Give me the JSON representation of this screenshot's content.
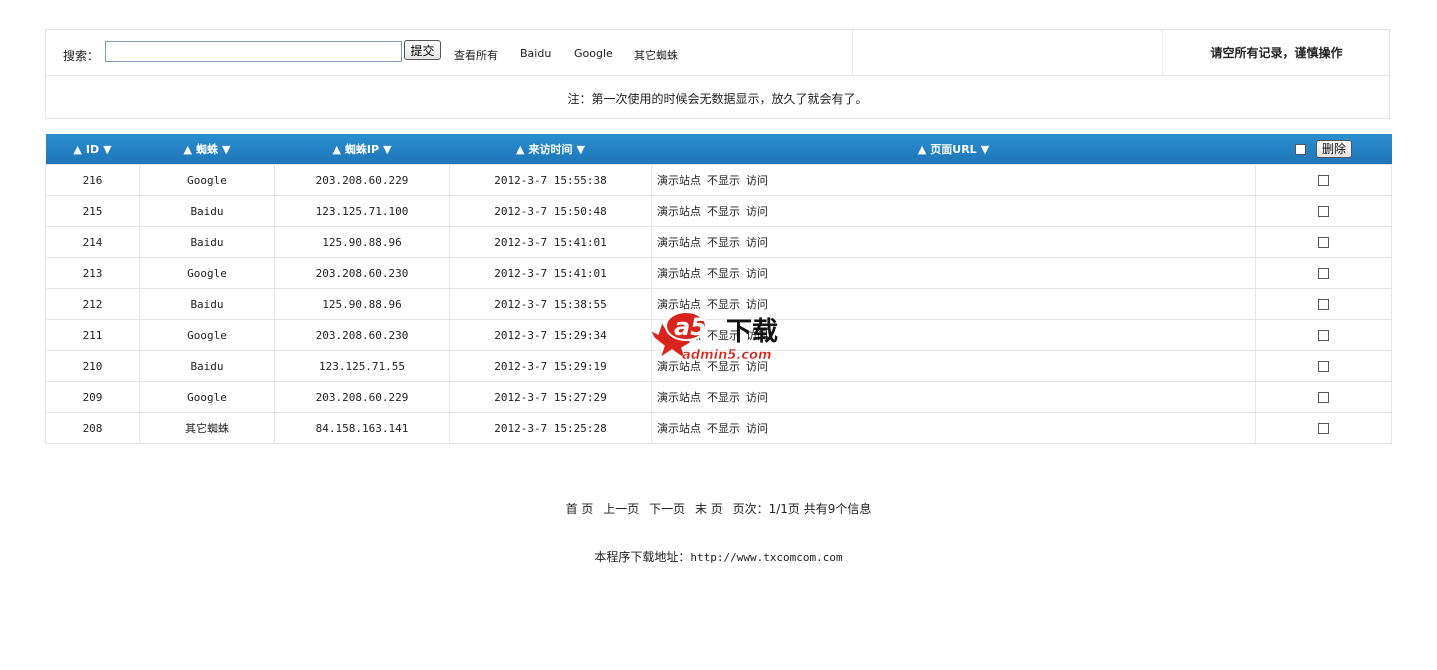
{
  "search": {
    "label": "搜索：",
    "value": "",
    "submit_label": "提交",
    "filters": [
      "查看所有",
      "Baidu",
      "Google",
      "其它蜘蛛"
    ]
  },
  "clear_all_label": "请空所有记录，谨慎操作",
  "note": "注：第一次使用的时候会无数据显示，放久了就会有了。",
  "table": {
    "headers": [
      "ID",
      "蜘蛛",
      "蜘蛛IP",
      "来访时间",
      "页面URL"
    ],
    "delete_label": "删除",
    "rows": [
      {
        "id": "216",
        "spider": "Google",
        "ip": "203.208.60.229",
        "time": "2012-3-7 15:55:38",
        "site": "演示站点",
        "hide": "不显示",
        "visit": "访问"
      },
      {
        "id": "215",
        "spider": "Baidu",
        "ip": "123.125.71.100",
        "time": "2012-3-7 15:50:48",
        "site": "演示站点",
        "hide": "不显示",
        "visit": "访问"
      },
      {
        "id": "214",
        "spider": "Baidu",
        "ip": "125.90.88.96",
        "time": "2012-3-7 15:41:01",
        "site": "演示站点",
        "hide": "不显示",
        "visit": "访问"
      },
      {
        "id": "213",
        "spider": "Google",
        "ip": "203.208.60.230",
        "time": "2012-3-7 15:41:01",
        "site": "演示站点",
        "hide": "不显示",
        "visit": "访问"
      },
      {
        "id": "212",
        "spider": "Baidu",
        "ip": "125.90.88.96",
        "time": "2012-3-7 15:38:55",
        "site": "演示站点",
        "hide": "不显示",
        "visit": "访问"
      },
      {
        "id": "211",
        "spider": "Google",
        "ip": "203.208.60.230",
        "time": "2012-3-7 15:29:34",
        "site": "演示站点",
        "hide": "不显示",
        "visit": "访问"
      },
      {
        "id": "210",
        "spider": "Baidu",
        "ip": "123.125.71.55",
        "time": "2012-3-7 15:29:19",
        "site": "演示站点",
        "hide": "不显示",
        "visit": "访问"
      },
      {
        "id": "209",
        "spider": "Google",
        "ip": "203.208.60.229",
        "time": "2012-3-7 15:27:29",
        "site": "演示站点",
        "hide": "不显示",
        "visit": "访问"
      },
      {
        "id": "208",
        "spider": "其它蜘蛛",
        "ip": "84.158.163.141",
        "time": "2012-3-7 15:25:28",
        "site": "演示站点",
        "hide": "不显示",
        "visit": "访问"
      }
    ]
  },
  "pager": {
    "first": "首 页",
    "prev": "上一页",
    "next": "下一页",
    "last": "末 页",
    "info": "页次：1/1页 共有9个信息"
  },
  "footer": {
    "label": "本程序下载地址：",
    "url": "http://www.txcomcom.com"
  },
  "watermark": {
    "logo_text": "a5",
    "tagline": "下载",
    "domain": "admin5.com"
  },
  "colors": {
    "header_bg": "#1e76b8",
    "google": "#c00000",
    "baidu": "#000080",
    "watermark_red": "#d8241c"
  }
}
